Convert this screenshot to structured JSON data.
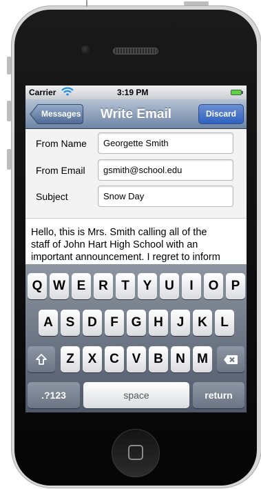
{
  "status_bar": {
    "carrier": "Carrier",
    "time": "3:19 PM"
  },
  "nav": {
    "back_label": "Messages",
    "title": "Write Email",
    "discard_label": "Discard"
  },
  "form": {
    "from_name_label": "From Name",
    "from_name_value": "Georgette Smith",
    "from_email_label": "From Email",
    "from_email_value": "gsmith@school.edu",
    "subject_label": "Subject",
    "subject_value": "Snow Day"
  },
  "body": {
    "line1": "Hello, this is Mrs. Smith calling all of the",
    "line2": "staff of John Hart High School with an",
    "line3": "important announcement. I regret to inform"
  },
  "keyboard": {
    "row1": [
      "Q",
      "W",
      "E",
      "R",
      "T",
      "Y",
      "U",
      "I",
      "O",
      "P"
    ],
    "row2": [
      "A",
      "S",
      "D",
      "F",
      "G",
      "H",
      "J",
      "K",
      "L"
    ],
    "row3": [
      "Z",
      "X",
      "C",
      "V",
      "B",
      "N",
      "M"
    ],
    "numbers_label": ".?123",
    "space_label": "space",
    "return_label": "return",
    "shift_icon": "shift-arrow-icon",
    "delete_icon": "backspace-icon"
  }
}
